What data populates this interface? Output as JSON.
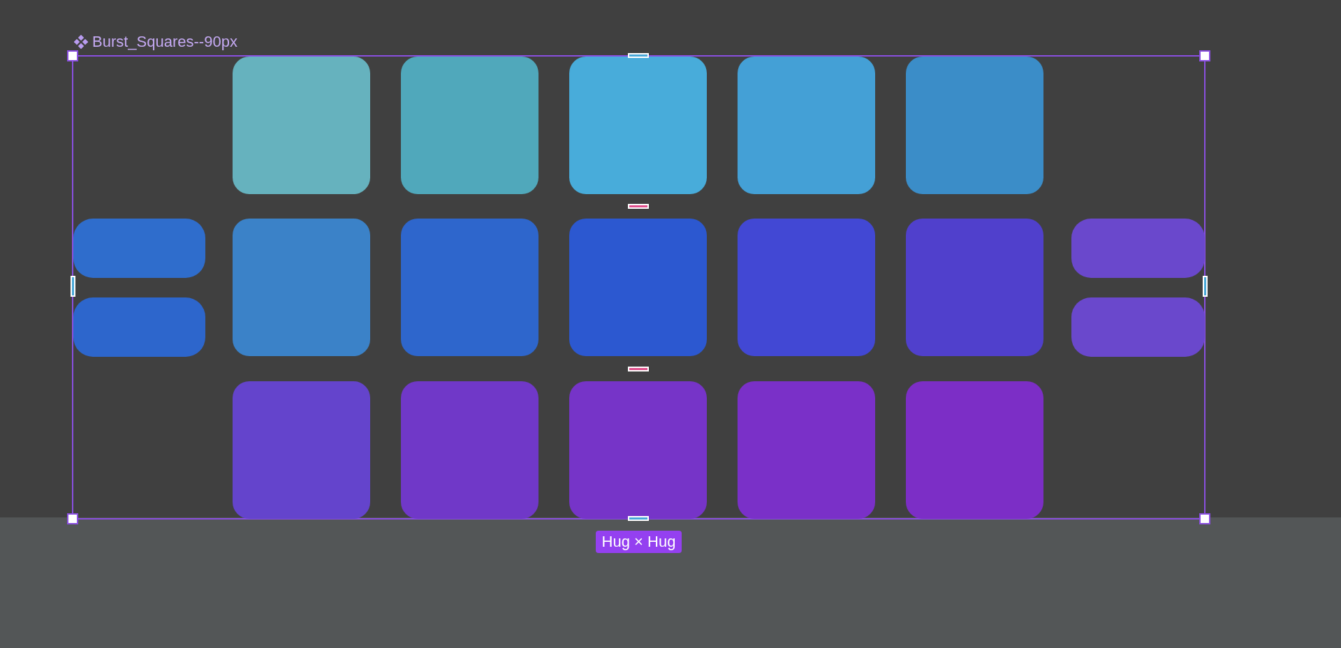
{
  "frame": {
    "name": "Burst_Squares--90px",
    "size_badge": "Hug × Hug"
  },
  "left_pills": [
    {
      "color": "#2f6dcc"
    },
    {
      "color": "#2d66cc"
    }
  ],
  "square_rows": [
    [
      {
        "color": "#66b2be"
      },
      {
        "color": "#50a8bb"
      },
      {
        "color": "#48acda"
      },
      {
        "color": "#44a0d6"
      },
      {
        "color": "#3b8dc8"
      }
    ],
    [
      {
        "color": "#3b82c8"
      },
      {
        "color": "#2e66cc"
      },
      {
        "color": "#2c58d0"
      },
      {
        "color": "#4248d4"
      },
      {
        "color": "#5040cc"
      }
    ],
    [
      {
        "color": "#6444cc"
      },
      {
        "color": "#7038c8"
      },
      {
        "color": "#7634c8"
      },
      {
        "color": "#7a30c8"
      },
      {
        "color": "#7c2ec6"
      }
    ]
  ],
  "right_pills": [
    {
      "color": "#6a48cc"
    },
    {
      "color": "#6a48cc"
    }
  ]
}
